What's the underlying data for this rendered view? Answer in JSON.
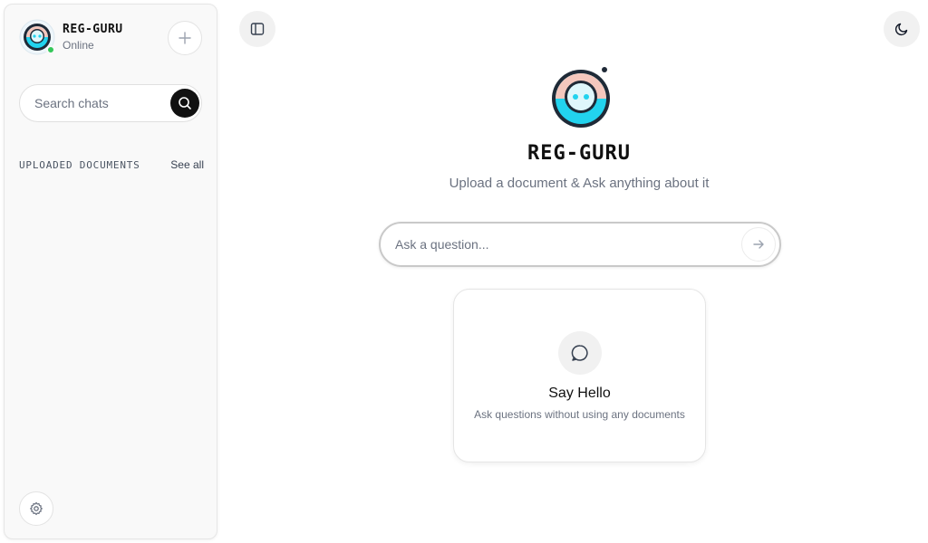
{
  "app": {
    "name": "REG-GURU",
    "status": "Online",
    "colors": {
      "accent": "#22d3ee",
      "online": "#34c759",
      "dark": "#111111"
    }
  },
  "sidebar": {
    "search": {
      "placeholder": "Search chats"
    },
    "section_title": "UPLOADED DOCUMENTS",
    "see_all": "See all",
    "icons": {
      "new_chat": "plus-icon",
      "search": "search-icon",
      "settings": "gear-icon"
    }
  },
  "header": {
    "icons": {
      "toggle_sidebar": "sidebar-toggle-icon",
      "theme": "moon-icon"
    }
  },
  "main": {
    "title": "REG-GURU",
    "subtitle": "Upload a document & Ask anything about it",
    "ask": {
      "placeholder": "Ask a question..."
    },
    "card": {
      "title": "Say Hello",
      "description": "Ask questions without using any documents",
      "icon": "chat-bubble-icon"
    }
  }
}
